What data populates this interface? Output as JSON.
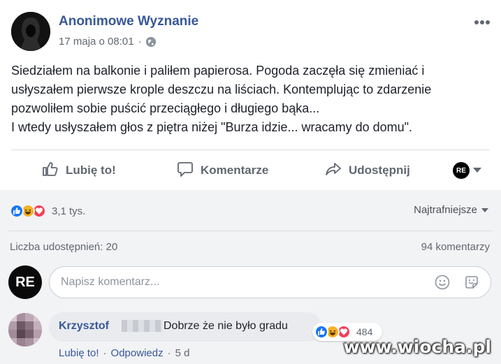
{
  "post": {
    "author": "Anonimowe Wyznanie",
    "timestamp": "17 maja o 08:01",
    "separator": "·",
    "more_icon": "more-dots-icon",
    "privacy_icon": "globe-icon",
    "text_lines": [
      "Siedziałem na balkonie i paliłem papierosa. Pogoda zaczęła się zmieniać i",
      "usłyszałem pierwsze krople deszczu na liściach. Kontemplując to zdarzenie",
      "pozwoliłem sobie puścić przeciągłego i długiego bąka...",
      "I wtedy usłyszałem głos z piętra niżej \"Burza idzie... wracamy do domu\"."
    ]
  },
  "actions": {
    "like": "Lubię to!",
    "comment": "Komentarze",
    "share": "Udostępnij",
    "profile_badge": "RE"
  },
  "engagement": {
    "reaction_count": "3,1 tys.",
    "sort_label": "Najtrafniejsze",
    "shares": "Liczba udostępnień: 20",
    "comments": "94 komentarzy"
  },
  "composer": {
    "avatar_text": "RE",
    "placeholder": "Napisz komentarz..."
  },
  "comment": {
    "author": "Krzysztof",
    "text": "Dobrze że nie było gradu",
    "reaction_count": "484",
    "like_label": "Lubię to!",
    "reply_label": "Odpowiedz",
    "separator": "·",
    "time": "5 d"
  },
  "watermark": "www.wiocha.pl",
  "colors": {
    "link": "#385898",
    "like": "#1877f2",
    "haha": "#f7b125",
    "love": "#f33e58",
    "panel": "#f2f3f5"
  }
}
